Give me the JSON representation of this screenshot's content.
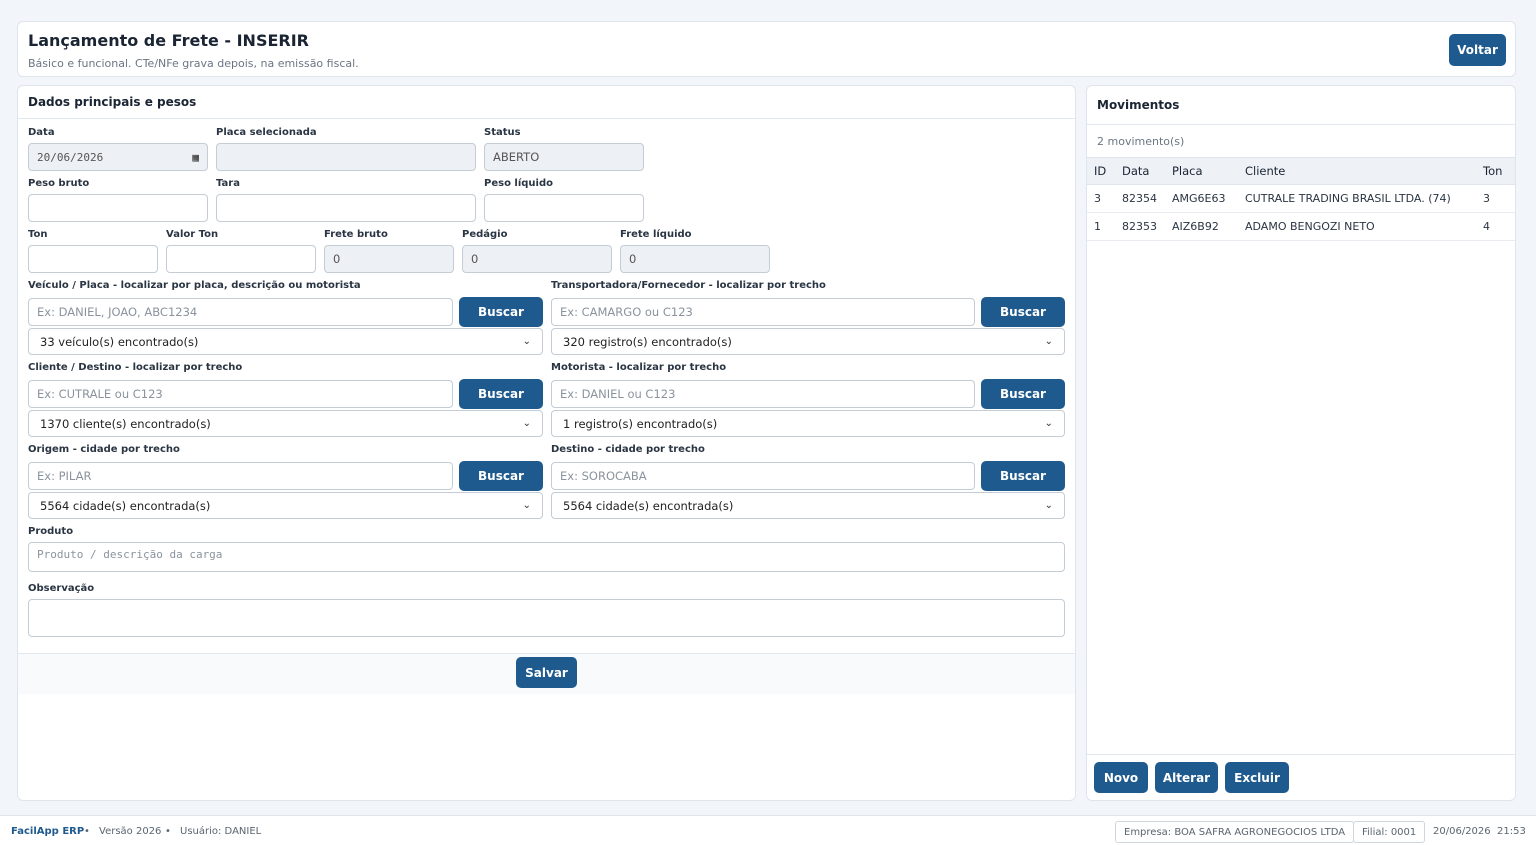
{
  "header": {
    "title": "Lançamento de Frete - INSERIR",
    "subtitle": "Básico e funcional. CTe/NFe grava depois, na emissão fiscal.",
    "back_label": "Voltar"
  },
  "form": {
    "section_title": "Dados principais e pesos",
    "data": {
      "label": "Data",
      "value": "20/06/2026"
    },
    "placa_selecionada": {
      "label": "Placa selecionada",
      "value": ""
    },
    "status": {
      "label": "Status",
      "value": "ABERTO"
    },
    "peso_bruto": {
      "label": "Peso bruto",
      "value": ""
    },
    "tara": {
      "label": "Tara",
      "value": ""
    },
    "peso_liquido": {
      "label": "Peso líquido",
      "value": ""
    },
    "ton": {
      "label": "Ton",
      "value": ""
    },
    "valor_ton": {
      "label": "Valor Ton",
      "value": ""
    },
    "frete_bruto": {
      "label": "Frete bruto",
      "value": "0"
    },
    "pedagio": {
      "label": "Pedágio",
      "value": "0"
    },
    "frete_liquido": {
      "label": "Frete líquido",
      "value": "0"
    },
    "veiculo": {
      "label": "Veículo / Placa - localizar por placa, descrição ou motorista",
      "placeholder": "Ex: DANIEL, JOAO, ABC1234",
      "button": "Buscar",
      "selected": "33 veículo(s) encontrado(s)"
    },
    "transportadora": {
      "label": "Transportadora/Fornecedor - localizar por trecho",
      "placeholder": "Ex: CAMARGO ou C123",
      "button": "Buscar",
      "selected": "320 registro(s) encontrado(s)"
    },
    "cliente": {
      "label": "Cliente / Destino - localizar por trecho",
      "placeholder": "Ex: CUTRALE ou C123",
      "button": "Buscar",
      "selected": "1370 cliente(s) encontrado(s)"
    },
    "motorista": {
      "label": "Motorista - localizar por trecho",
      "placeholder": "Ex: DANIEL ou C123",
      "button": "Buscar",
      "selected": "1 registro(s) encontrado(s)"
    },
    "origem": {
      "label": "Origem - cidade por trecho",
      "placeholder": "Ex: PILAR",
      "button": "Buscar",
      "selected": "5564 cidade(s) encontrada(s)"
    },
    "destino": {
      "label": "Destino - cidade por trecho",
      "placeholder": "Ex: SOROCABA",
      "button": "Buscar",
      "selected": "5564 cidade(s) encontrada(s)"
    },
    "produto": {
      "label": "Produto",
      "placeholder": "Produto / descrição da carga"
    },
    "observacao": {
      "label": "Observação",
      "value": ""
    },
    "save_label": "Salvar"
  },
  "movimentos": {
    "title": "Movimentos",
    "count": "2 movimento(s)",
    "columns": [
      "ID",
      "Data",
      "Placa",
      "Cliente",
      "Ton"
    ],
    "rows": [
      [
        "3",
        "82354",
        "AMG6E63",
        "CUTRALE TRADING BRASIL LTDA. (74)",
        "3"
      ],
      [
        "1",
        "82353",
        "AIZ6B92",
        "ADAMO BENGOZI NETO",
        "4"
      ]
    ],
    "buttons": {
      "novo": "Novo",
      "alterar": "Alterar",
      "excluir": "Excluir"
    }
  },
  "statusbar": {
    "app": "FacilApp ERP",
    "version": "Versão 2026",
    "user": "Usuário: DANIEL",
    "empresa": "Empresa: BOA SAFRA AGRONEGOCIOS LTDA",
    "filial": "Filial: 0001",
    "date": "20/06/2026",
    "time": "21:53"
  },
  "colors": {
    "primary": "#1f5a8e",
    "background": "#f2f5f9"
  },
  "icons": {
    "calendar": "calendar-icon",
    "chevron": "chevron-down-icon"
  }
}
